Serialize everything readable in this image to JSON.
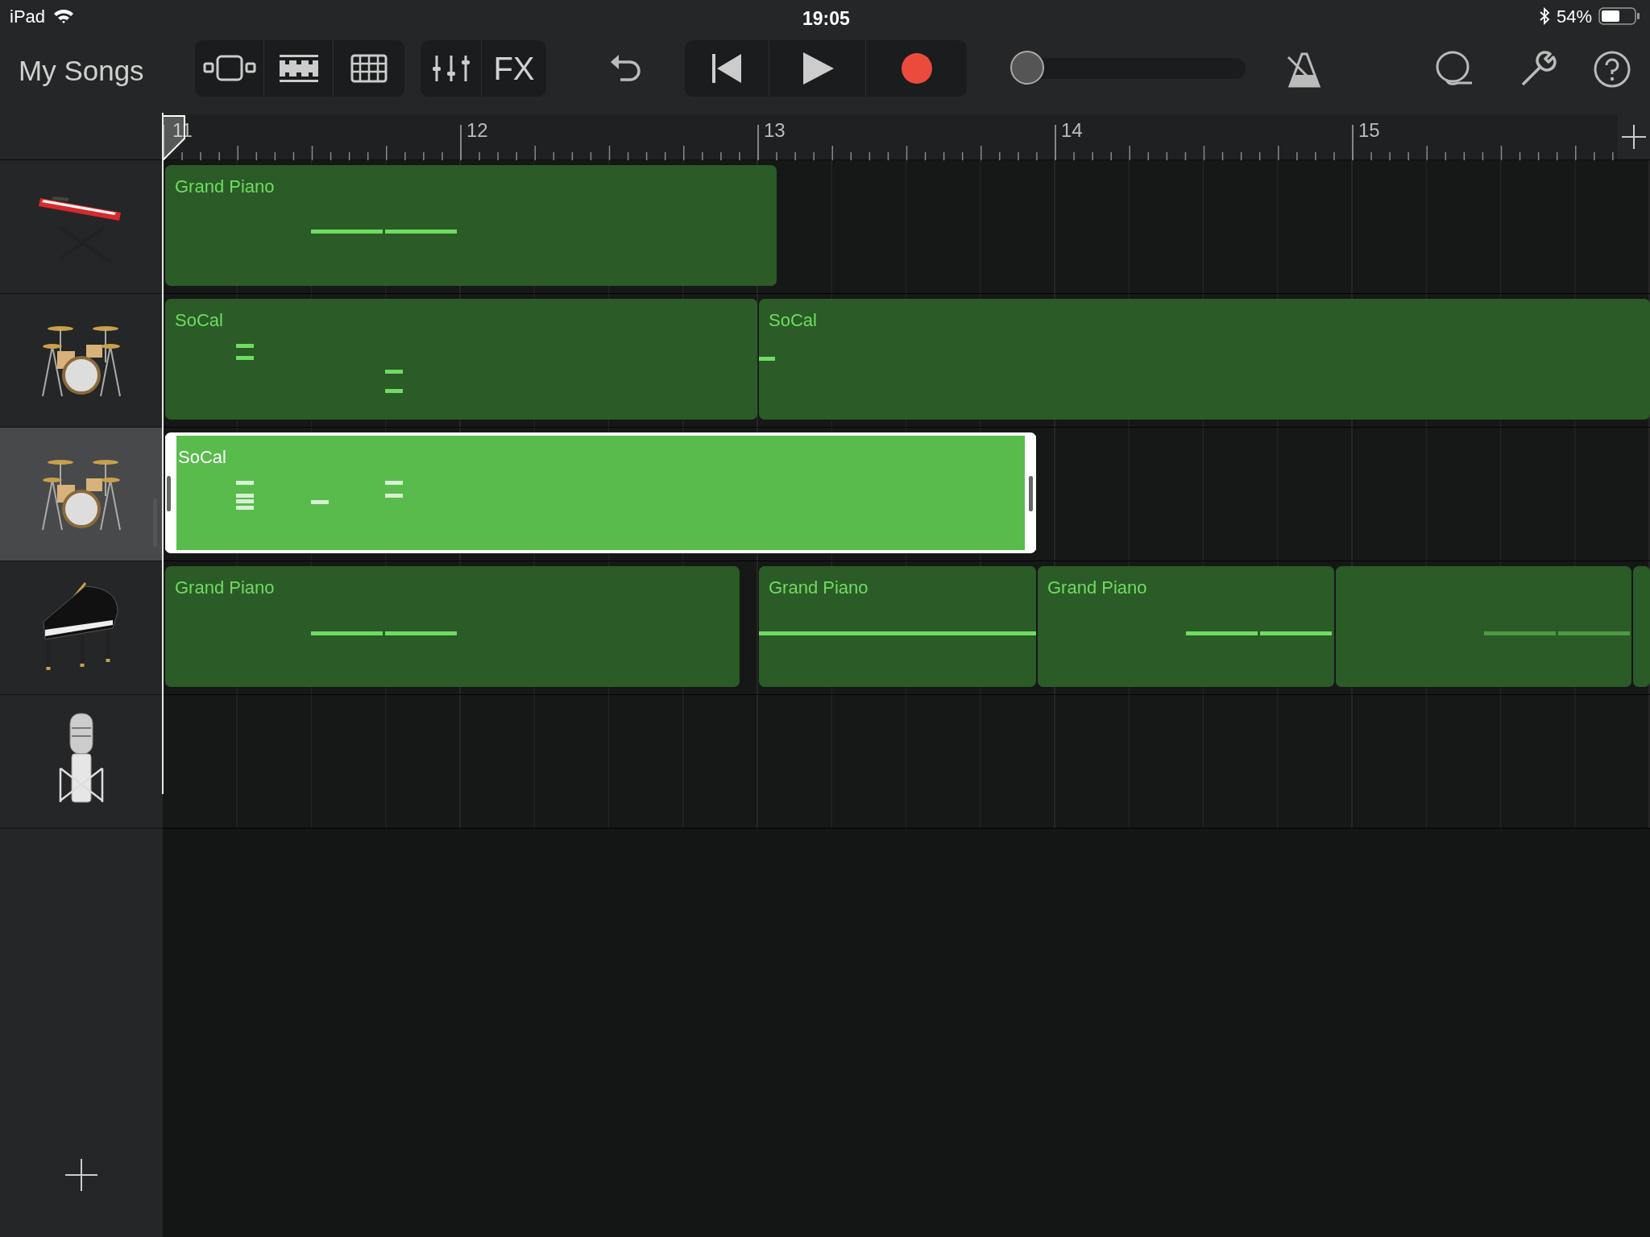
{
  "status_bar": {
    "device": "iPad",
    "time": "19:05",
    "battery": "54%"
  },
  "toolbar": {
    "back": "My Songs",
    "fx_label": "FX",
    "record_armed": true,
    "volume": {
      "level": 0.0
    }
  },
  "ruler": {
    "bars": [
      "11",
      "12",
      "13",
      "14",
      "15"
    ]
  },
  "tracks": [
    {
      "kind": "keyboard",
      "selected": false,
      "regions": [
        {
          "name": "Grand Piano",
          "selected": false
        }
      ]
    },
    {
      "kind": "drums",
      "selected": false,
      "regions": [
        {
          "name": "SoCal",
          "selected": false
        },
        {
          "name": "SoCal",
          "selected": false
        }
      ]
    },
    {
      "kind": "drums",
      "selected": true,
      "regions": [
        {
          "name": "SoCal",
          "selected": true
        }
      ]
    },
    {
      "kind": "piano",
      "selected": false,
      "regions": [
        {
          "name": "Grand Piano",
          "selected": false
        },
        {
          "name": "Grand Piano",
          "selected": false
        },
        {
          "name": "Grand Piano",
          "selected": false
        },
        {
          "selected": false
        },
        {
          "selected": false
        }
      ]
    },
    {
      "kind": "microphone",
      "selected": false
    }
  ]
}
